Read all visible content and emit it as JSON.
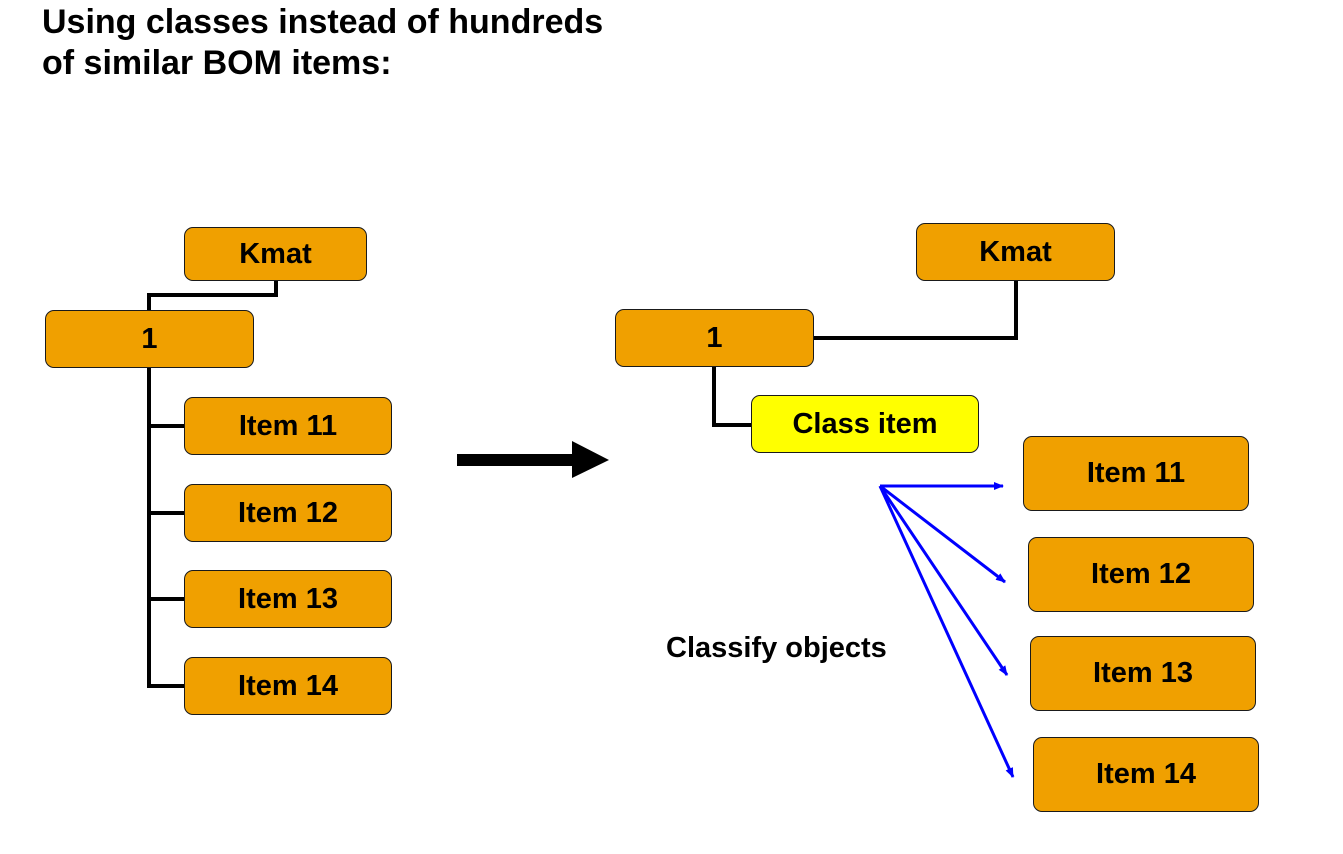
{
  "title": {
    "line1": "Using classes instead of hundreds",
    "line2": "of similar BOM items:"
  },
  "colors": {
    "item_fill": "#f0a000",
    "class_item_fill": "#ffff00",
    "connector": "#000000",
    "classify_arrow": "#0000ff"
  },
  "left_tree": {
    "root": "Kmat",
    "node": "1",
    "items": [
      "Item 11",
      "Item 12",
      "Item 13",
      "Item 14"
    ]
  },
  "transition_arrow": "right-arrow",
  "right_tree": {
    "root": "Kmat",
    "node": "1",
    "class_item": "Class item",
    "classify_label": "Classify objects",
    "items": [
      "Item 11",
      "Item 12",
      "Item 13",
      "Item 14"
    ]
  }
}
